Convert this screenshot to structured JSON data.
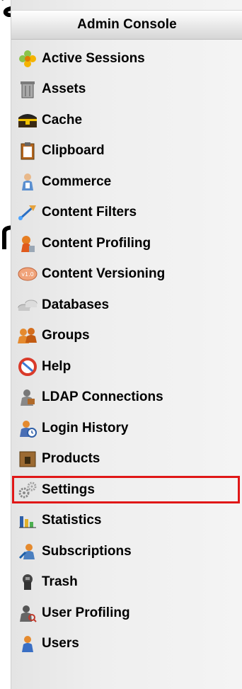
{
  "panel": {
    "title": "Admin Console"
  },
  "menu": {
    "items": [
      {
        "label": "Active Sessions",
        "icon": "flower-icon"
      },
      {
        "label": "Assets",
        "icon": "trash-can-icon"
      },
      {
        "label": "Cache",
        "icon": "treasure-chest-icon"
      },
      {
        "label": "Clipboard",
        "icon": "clipboard-icon"
      },
      {
        "label": "Commerce",
        "icon": "person-icon"
      },
      {
        "label": "Content Filters",
        "icon": "funnel-icon"
      },
      {
        "label": "Content Profiling",
        "icon": "profile-icon"
      },
      {
        "label": "Content Versioning",
        "icon": "version-badge-icon"
      },
      {
        "label": "Databases",
        "icon": "database-icon"
      },
      {
        "label": "Groups",
        "icon": "group-icon"
      },
      {
        "label": "Help",
        "icon": "help-ring-icon"
      },
      {
        "label": "LDAP Connections",
        "icon": "ldap-user-icon"
      },
      {
        "label": "Login History",
        "icon": "login-history-icon"
      },
      {
        "label": "Products",
        "icon": "box-icon"
      },
      {
        "label": "Settings",
        "icon": "gears-icon"
      },
      {
        "label": "Statistics",
        "icon": "bar-chart-icon"
      },
      {
        "label": "Subscriptions",
        "icon": "subscription-icon"
      },
      {
        "label": "Trash",
        "icon": "trash-icon"
      },
      {
        "label": "User Profiling",
        "icon": "user-search-icon"
      },
      {
        "label": "Users",
        "icon": "user-icon"
      }
    ],
    "selected": "Settings"
  },
  "colors": {
    "selection_border": "#e01717",
    "panel_bg": "#f0f0f0"
  }
}
